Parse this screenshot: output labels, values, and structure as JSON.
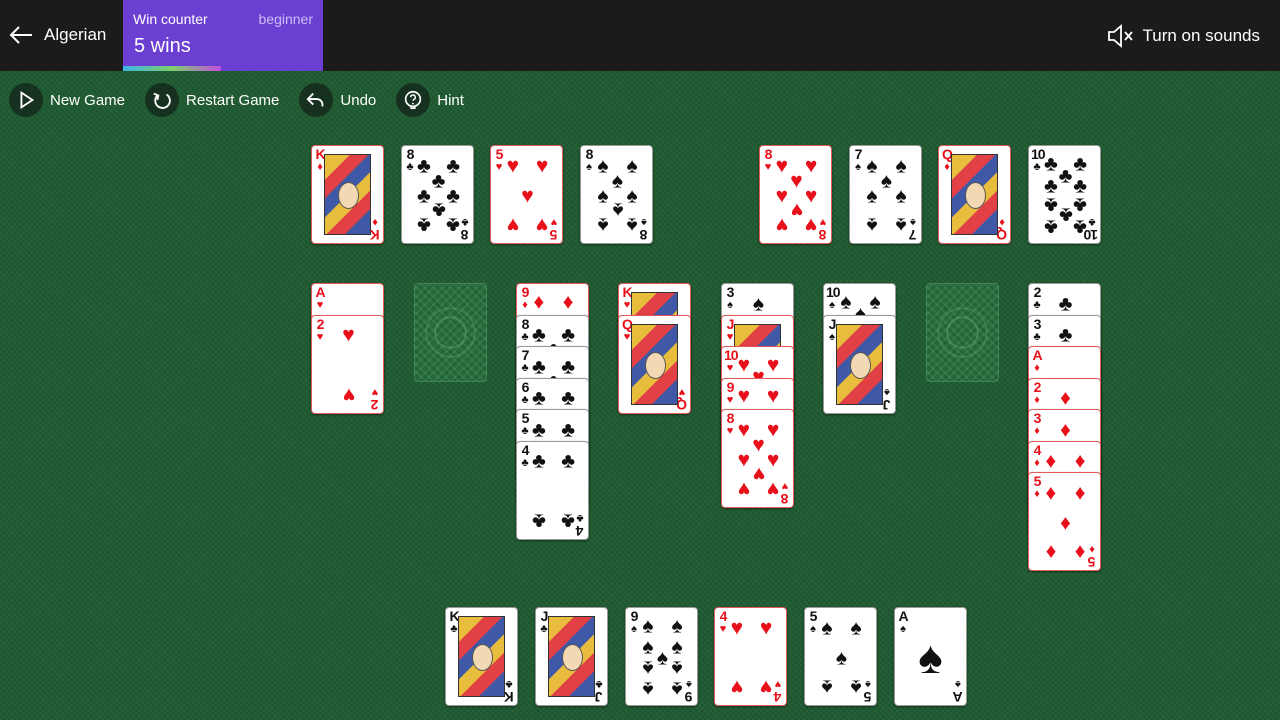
{
  "topbar": {
    "back_label": "Algerian",
    "win_counter": {
      "title": "Win counter",
      "level": "beginner",
      "value": "5 wins",
      "progress": 0.49
    },
    "sound_label": "Turn on sounds"
  },
  "toolbar": [
    {
      "label": "New Game",
      "icon": "play-icon",
      "name": "new-game-button"
    },
    {
      "label": "Restart Game",
      "icon": "restart-icon",
      "name": "restart-game-button"
    },
    {
      "label": "Undo",
      "icon": "undo-icon",
      "name": "undo-button"
    },
    {
      "label": "Hint",
      "icon": "hint-icon",
      "name": "hint-button"
    }
  ],
  "colors": {
    "felt": "#1e5a30",
    "topbar": "#1b1b1b",
    "win_counter": "#6a3fd1",
    "red_suit": "#e8101a",
    "black_suit": "#111111"
  },
  "foundations": [
    {
      "rank": "K",
      "suit": "♦"
    },
    {
      "rank": "8",
      "suit": "♣"
    },
    {
      "rank": "5",
      "suit": "♥"
    },
    {
      "rank": "8",
      "suit": "♠"
    },
    {
      "rank": "8",
      "suit": "♥"
    },
    {
      "rank": "7",
      "suit": "♠"
    },
    {
      "rank": "Q",
      "suit": "♦"
    },
    {
      "rank": "10",
      "suit": "♣"
    }
  ],
  "tableau": [
    [
      {
        "rank": "A",
        "suit": "♥"
      },
      {
        "rank": "2",
        "suit": "♥"
      }
    ],
    [],
    [
      {
        "rank": "9",
        "suit": "♦"
      },
      {
        "rank": "8",
        "suit": "♣"
      },
      {
        "rank": "7",
        "suit": "♣"
      },
      {
        "rank": "6",
        "suit": "♣"
      },
      {
        "rank": "5",
        "suit": "♣"
      },
      {
        "rank": "4",
        "suit": "♣"
      }
    ],
    [
      {
        "rank": "K",
        "suit": "♥"
      },
      {
        "rank": "Q",
        "suit": "♥"
      }
    ],
    [
      {
        "rank": "3",
        "suit": "♠"
      },
      {
        "rank": "J",
        "suit": "♥"
      },
      {
        "rank": "10",
        "suit": "♥"
      },
      {
        "rank": "9",
        "suit": "♥"
      },
      {
        "rank": "8",
        "suit": "♥"
      }
    ],
    [
      {
        "rank": "10",
        "suit": "♠"
      },
      {
        "rank": "J",
        "suit": "♠"
      }
    ],
    [],
    [
      {
        "rank": "2",
        "suit": "♣"
      },
      {
        "rank": "3",
        "suit": "♣"
      },
      {
        "rank": "A",
        "suit": "♦"
      },
      {
        "rank": "2",
        "suit": "♦"
      },
      {
        "rank": "3",
        "suit": "♦"
      },
      {
        "rank": "4",
        "suit": "♦"
      },
      {
        "rank": "5",
        "suit": "♦"
      }
    ]
  ],
  "reserve": [
    {
      "rank": "K",
      "suit": "♣"
    },
    {
      "rank": "J",
      "suit": "♣"
    },
    {
      "rank": "9",
      "suit": "♠"
    },
    {
      "rank": "4",
      "suit": "♥"
    },
    {
      "rank": "5",
      "suit": "♠"
    },
    {
      "rank": "A",
      "suit": "♠"
    }
  ]
}
